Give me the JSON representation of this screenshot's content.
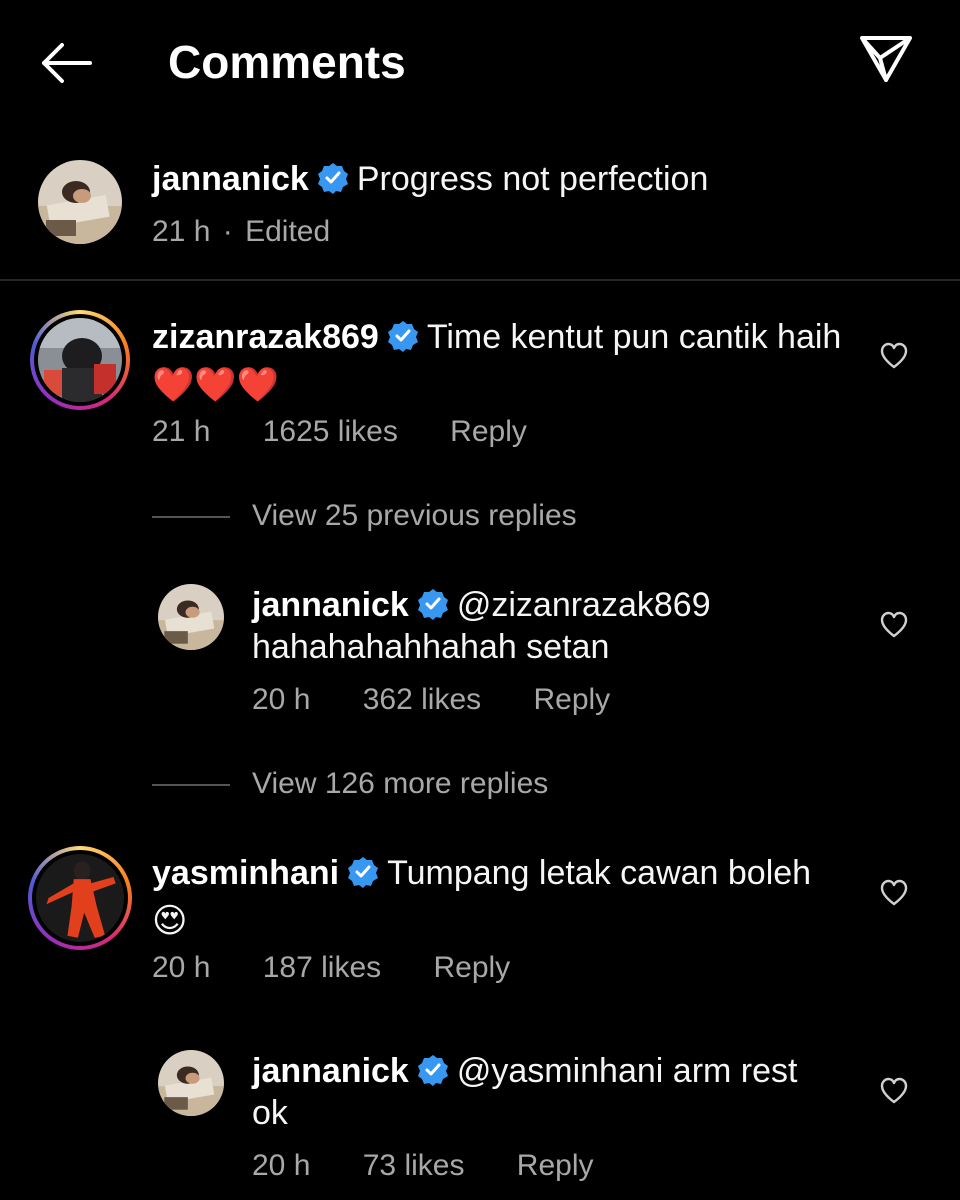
{
  "header": {
    "title": "Comments",
    "back_icon": "arrow-left-icon",
    "share_icon": "send-icon"
  },
  "caption": {
    "username": "jannanick",
    "text": "Progress not perfection",
    "time": "21 h",
    "separator": "·",
    "edited": "Edited"
  },
  "comments": [
    {
      "username": "zizanrazak869",
      "text": "Time kentut pun cantik haih",
      "emoji": "❤️❤️❤️",
      "time": "21 h",
      "likes": "1625 likes",
      "reply_label": "Reply",
      "view_replies": "View 25 previous replies",
      "reply": {
        "username": "jannanick",
        "text": "@zizanrazak869 hahahahahhahah setan",
        "time": "20 h",
        "likes": "362 likes",
        "reply_label": "Reply"
      },
      "more_replies": "View 126 more replies"
    },
    {
      "username": "yasminhani",
      "text": "Tumpang letak cawan boleh",
      "emoji": "😍",
      "time": "20 h",
      "likes": "187 likes",
      "reply_label": "Reply",
      "reply": {
        "username": "jannanick",
        "text": "@yasminhani arm rest ok",
        "time": "20 h",
        "likes": "73 likes",
        "reply_label": "Reply"
      }
    }
  ],
  "colors": {
    "background": "#000000",
    "text": "#f5f5f5",
    "secondary": "#a8a8a8",
    "verified": "#3897f0",
    "heart": "#ed1c24"
  }
}
